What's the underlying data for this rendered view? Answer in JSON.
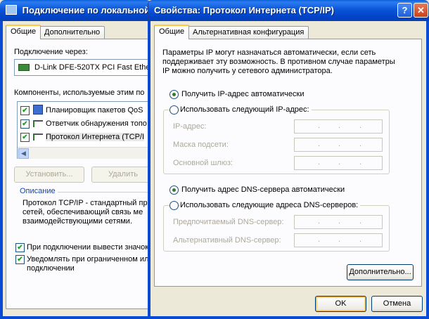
{
  "back_window": {
    "title": "Подключение по локальной",
    "tabs": [
      "Общие",
      "Дополнительно"
    ],
    "connect_via_label": "Подключение через:",
    "adapter_name": "D-Link DFE-520TX PCI Fast Ethe",
    "components_label": "Компоненты, используемые этим по",
    "components": [
      {
        "label": "Планировщик пакетов QoS",
        "checked": true
      },
      {
        "label": "Ответчик обнаружения топо",
        "checked": true
      },
      {
        "label": "Протокол Интернета (TCP/I",
        "checked": true
      }
    ],
    "install_button": "Установить...",
    "remove_button": "Удалить",
    "description_title": "Описание",
    "description_text": [
      "Протокол TCP/IP - стандартный пр",
      "сетей, обеспечивающий связь ме",
      "взаимодействующими сетями."
    ],
    "show_icon_label": "При подключении вывести значок",
    "notify_label": [
      "Уведомлять при ограниченном ил",
      "подключении"
    ]
  },
  "dialog": {
    "title": "Свойства: Протокол Интернета (TCP/IP)",
    "help_glyph": "?",
    "close_glyph": "✕",
    "tabs": [
      "Общие",
      "Альтернативная конфигурация"
    ],
    "intro_text": [
      "Параметры IP могут назначаться автоматически, если сеть",
      "поддерживает эту возможность. В противном случае параметры",
      "IP можно получить у сетевого администратора."
    ],
    "ip_auto_label": "Получить IP-адрес автоматически",
    "ip_manual_label": "Использовать следующий IP-адрес:",
    "ip_fields": [
      {
        "label": "IP-адрес:"
      },
      {
        "label": "Маска подсети:"
      },
      {
        "label": "Основной шлюз:"
      }
    ],
    "dns_auto_label": "Получить адрес DNS-сервера автоматически",
    "dns_manual_label": "Использовать следующие адреса DNS-серверов:",
    "dns_fields": [
      {
        "label": "Предпочитаемый DNS-сервер:"
      },
      {
        "label": "Альтернативный DNS-сервер:"
      }
    ],
    "ip_dot": ".",
    "advanced_button": "Дополнительно...",
    "ok_button": "OK",
    "cancel_button": "Отмена",
    "ip_mode": "auto",
    "dns_mode": "auto"
  }
}
